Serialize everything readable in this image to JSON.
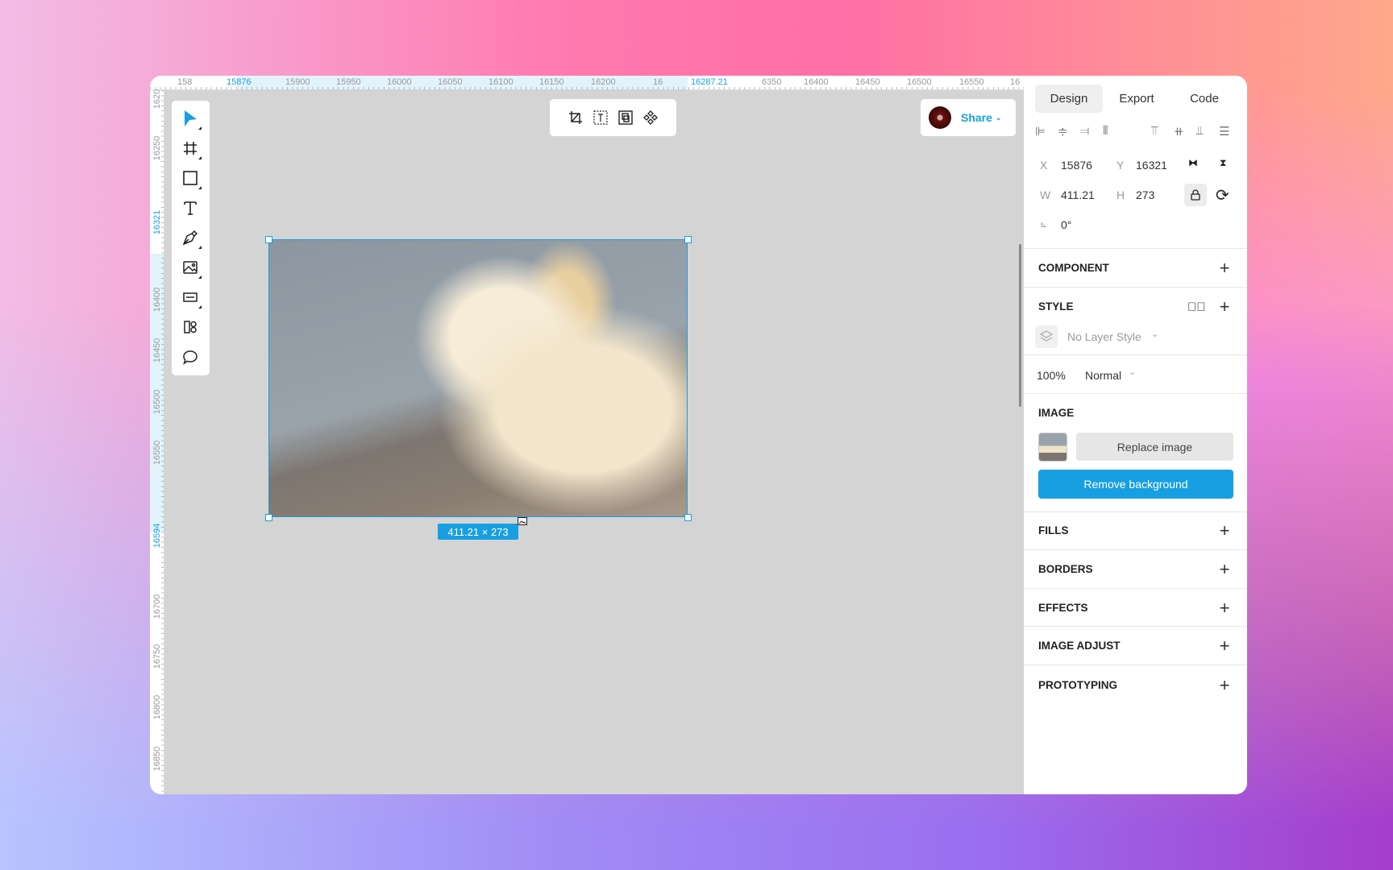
{
  "ruler_top": [
    "158",
    "15876",
    "15900",
    "15950",
    "16000",
    "16050",
    "16100",
    "16150",
    "16200",
    "16",
    "16287.21",
    "6350",
    "16400",
    "16450",
    "16500",
    "16550",
    "16"
  ],
  "ruler_left": [
    "1620",
    "16250",
    "16321",
    "16400",
    "16450",
    "16500",
    "16550",
    "16594",
    "16700",
    "16750",
    "16800",
    "16850"
  ],
  "share": {
    "label": "Share"
  },
  "selection": {
    "dimensions": "411.21 × 273"
  },
  "tabs": [
    "Design",
    "Export",
    "Code"
  ],
  "position": {
    "x_label": "X",
    "x": "15876",
    "y_label": "Y",
    "y": "16321",
    "w_label": "W",
    "w": "411.21",
    "h_label": "H",
    "h": "273",
    "rotation": "0°"
  },
  "sections": {
    "component": "COMPONENT",
    "style": "STYLE",
    "image": "IMAGE",
    "fills": "FILLS",
    "borders": "BORDERS",
    "effects": "EFFECTS",
    "image_adjust": "IMAGE ADJUST",
    "prototyping": "PROTOTYPING"
  },
  "style": {
    "layer_style": "No Layer Style"
  },
  "layer": {
    "opacity": "100%",
    "blend": "Normal"
  },
  "image": {
    "replace": "Replace image",
    "remove_bg": "Remove background"
  },
  "colors": {
    "accent": "#189fe2",
    "canvas": "#d4d4d4"
  }
}
